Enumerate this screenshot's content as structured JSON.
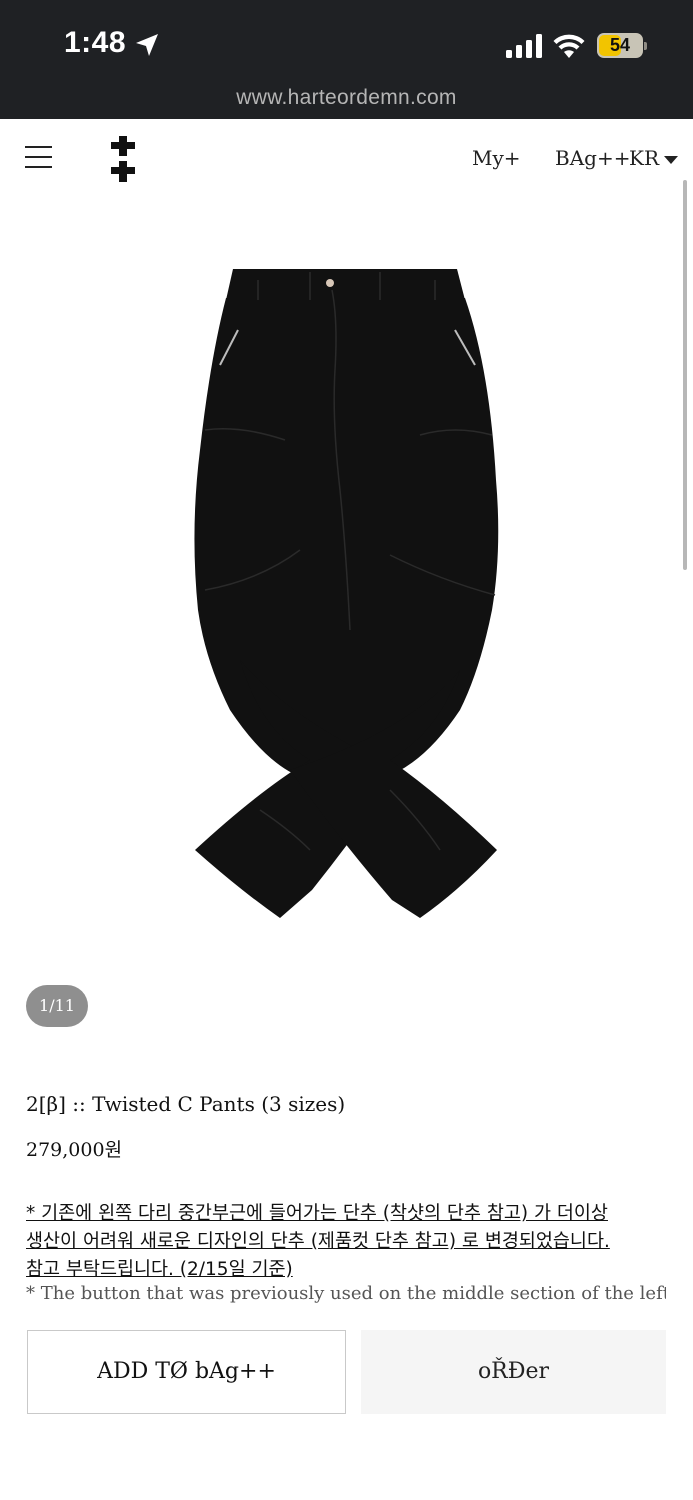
{
  "status_bar": {
    "time": "1:48",
    "battery": "54",
    "url": "www.harteordemn.com",
    "icons": [
      "location-arrow-icon",
      "signal-bars-icon",
      "wifi-icon",
      "battery-icon"
    ]
  },
  "header": {
    "menu_icon": "hamburger-icon",
    "logo_icon": "double-cross-logo",
    "my_label": "My+",
    "bag_label": "BAg++",
    "lang_label": "KR"
  },
  "gallery": {
    "counter": "1/11"
  },
  "product": {
    "title": "2[β] :: Twisted C Pants (3 sizes)",
    "price": "279,000원",
    "notice_ko": [
      "* 기존에 왼쪽 다리 중간부근에 들어가는 단추 (착샷의 단추 참고) 가 더이상",
      "생산이 어려워 새로운 디자인의 단추 (제품컷 단추 참고) 로 변경되었습니다.",
      "참고 부탁드립니다. (2/15일 기준)"
    ],
    "notice_en": "* The button that was previously used on the middle section of the left leg"
  },
  "actions": {
    "add_to_bag": "ADD TØ bAg++",
    "order": "oŘĐer"
  },
  "colors": {
    "status_bar_bg": "#1f2124",
    "pager_bg": "#8f8f8f",
    "order_bg": "#f5f5f5"
  }
}
